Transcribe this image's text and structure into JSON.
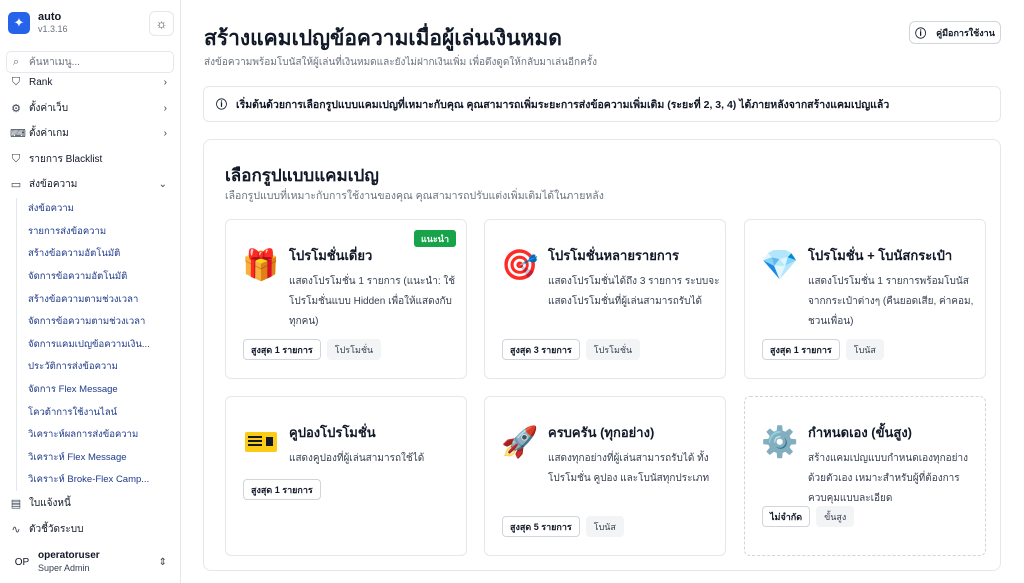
{
  "app": {
    "name": "auto",
    "version": "v1.3.16"
  },
  "search": {
    "placeholder": "ค้นหาเมนู..."
  },
  "sidebar": {
    "items": [
      {
        "label": "Rank",
        "icon": "shield-icon"
      },
      {
        "label": "ตั้งค่าเว็บ",
        "icon": "gear-icon"
      },
      {
        "label": "ตั้งค่าเกม",
        "icon": "gamepad-icon"
      },
      {
        "label": "รายการ Blacklist",
        "icon": "shield-icon"
      },
      {
        "label": "ส่งข้อความ",
        "icon": "message-icon"
      }
    ],
    "sub_items": [
      "ส่งข้อความ",
      "รายการส่งข้อความ",
      "สร้างข้อความอัตโนมัติ",
      "จัดการข้อความอัตโนมัติ",
      "สร้างข้อความตามช่วงเวลา",
      "จัดการข้อความตามช่วงเวลา",
      "จัดการแคมเปญข้อความเงิน...",
      "ประวัติการส่งข้อความ",
      "จัดการ Flex Message",
      "โควต้าการใช้งานไลน์",
      "วิเคราะห์ผลการส่งข้อความ",
      "วิเคราะห์ Flex Message",
      "วิเคราะห์ Broke-Flex Camp..."
    ],
    "bottom_items": [
      {
        "label": "ใบแจ้งหนี้",
        "icon": "invoice-icon"
      },
      {
        "label": "ตัวชี้วัดระบบ",
        "icon": "activity-icon"
      }
    ]
  },
  "user": {
    "initials": "OP",
    "name": "operatoruser",
    "role": "Super Admin"
  },
  "header": {
    "title": "สร้างแคมเปญข้อความเมื่อผู้เล่นเงินหมด",
    "subtitle": "ส่งข้อความพร้อมโบนัสให้ผู้เล่นที่เงินหมดและยังไม่ฝากเงินเพิ่ม เพื่อดึงดูดให้กลับมาเล่นอีกครั้ง",
    "help_label": "คู่มือการใช้งาน"
  },
  "alert": {
    "text": "เริ่มต้นด้วยการเลือกรูปแบบแคมเปญที่เหมาะกับคุณ คุณสามารถเพิ่มระยะการส่งข้อความเพิ่มเติม (ระยะที่ 2, 3, 4) ได้ภายหลังจากสร้างแคมเปญแล้ว"
  },
  "panel": {
    "title": "เลือกรูปแบบแคมเปญ",
    "subtitle": "เลือกรูปแบบที่เหมาะกับการใช้งานของคุณ คุณสามารถปรับแต่งเพิ่มเติมได้ในภายหลัง"
  },
  "cards": [
    {
      "title": "โปรโมชั่นเดี่ยว",
      "icon": "gift-icon",
      "glyph": "🎁",
      "badge": "แนะนำ",
      "desc": "แสดงโปรโมชั่น 1 รายการ (แนะนำ: ใช้โปรโมชั่นแบบ Hidden เพื่อให้แสดงกับทุกคน)",
      "tag_main": "สูงสุด 1 รายการ",
      "tag_sec": "โปรโมชั่น"
    },
    {
      "title": "โปรโมชั่นหลายรายการ",
      "icon": "target-icon",
      "glyph": "🎯",
      "desc": "แสดงโปรโมชั่นได้ถึง 3 รายการ ระบบจะแสดงโปรโมชั่นที่ผู้เล่นสามารถรับได้",
      "tag_main": "สูงสุด 3 รายการ",
      "tag_sec": "โปรโมชั่น"
    },
    {
      "title": "โปรโมชั่น + โบนัสกระเป๋า",
      "icon": "diamond-icon",
      "glyph": "💎",
      "desc": "แสดงโปรโมชั่น 1 รายการพร้อมโบนัสจากกระเป๋าต่างๆ (คืนยอดเสีย, ค่าคอม, ชวนเพื่อน)",
      "tag_main": "สูงสุด 1 รายการ",
      "tag_sec": "โบนัส"
    },
    {
      "title": "คูปองโปรโมชั่น",
      "icon": "ticket-icon",
      "glyph": "",
      "desc": "แสดงคูปองที่ผู้เล่นสามารถใช้ได้",
      "tag_main": "สูงสุด 1 รายการ",
      "tag_sec": ""
    },
    {
      "title": "ครบครัน (ทุกอย่าง)",
      "icon": "rocket-icon",
      "glyph": "🚀",
      "desc": "แสดงทุกอย่างที่ผู้เล่นสามารถรับได้ ทั้งโปรโมชั่น คูปอง และโบนัสทุกประเภท",
      "tag_main": "สูงสุด 5 รายการ",
      "tag_sec": "โบนัส"
    },
    {
      "title": "กำหนดเอง (ขั้นสูง)",
      "icon": "gear-icon",
      "glyph": "⚙️",
      "desc": "สร้างแคมเปญแบบกำหนดเองทุกอย่างด้วยตัวเอง เหมาะสำหรับผู้ที่ต้องการควบคุมแบบละเอียด",
      "tag_main": "ไม่จำกัด",
      "tag_sec": "ขั้นสูง"
    }
  ],
  "colors": {
    "accent": "#2563eb",
    "recommend_badge": "#16a34a",
    "sub_link": "#1e3a8a"
  }
}
